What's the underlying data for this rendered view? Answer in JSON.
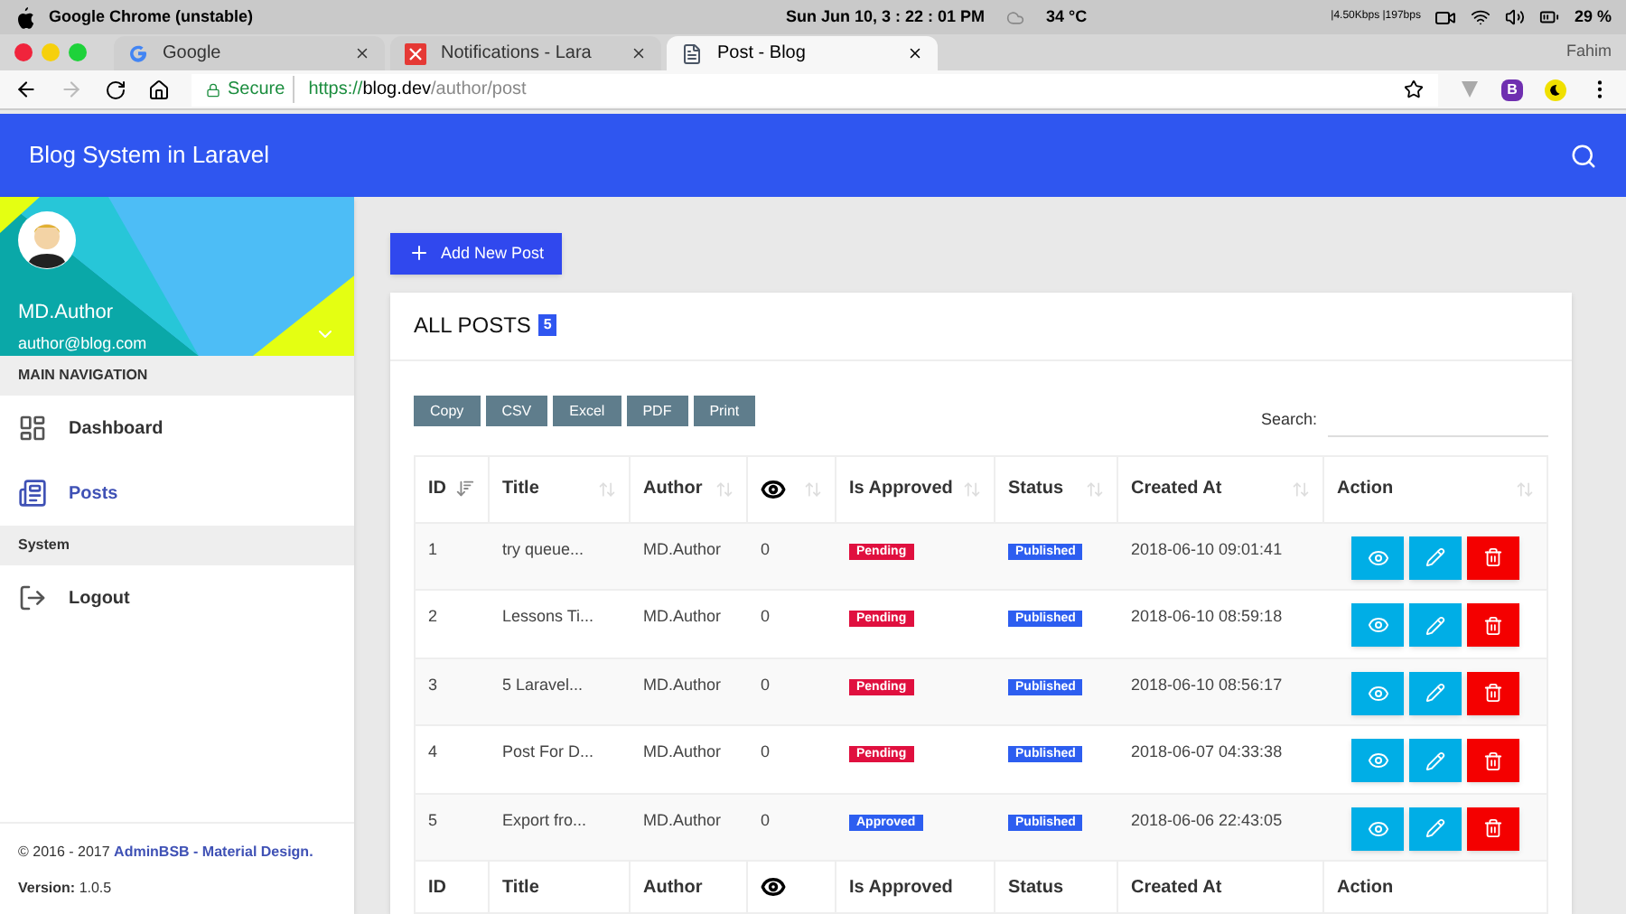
{
  "menu_bar": {
    "app_name": "Google Chrome (unstable)",
    "clock": "Sun Jun 10,  3 : 22 : 01 PM",
    "temperature": "34 °C",
    "network": "|4.50Kbps |197bps",
    "battery": "29 %"
  },
  "browser": {
    "tabs": [
      {
        "title": "Google",
        "selected": false,
        "kind": "google"
      },
      {
        "title": "Notifications - Lara",
        "selected": false,
        "kind": "app"
      },
      {
        "title": "Post - Blog",
        "selected": true,
        "kind": "page"
      }
    ],
    "profile": "Fahim",
    "extension_letter": "B",
    "secure_label": "Secure",
    "url_scheme": "https://",
    "url_host": "blog.dev",
    "url_path": "/author/post"
  },
  "app_bar": {
    "title": "Blog System in Laravel"
  },
  "sidebar": {
    "user_name": "MD.Author",
    "user_email": "author@blog.com",
    "sections": [
      {
        "header": "MAIN NAVIGATION",
        "items": [
          {
            "label": "Dashboard",
            "kind": "dashboard",
            "selected": false
          },
          {
            "label": "Posts",
            "kind": "posts",
            "selected": true
          }
        ]
      },
      {
        "header": "System",
        "items": [
          {
            "label": "Logout",
            "kind": "logout",
            "selected": false
          }
        ]
      }
    ],
    "copyright": "© 2016 - 2017 ",
    "copyright_link": "AdminBSB - Material Design.",
    "version_label": "Version:",
    "version": "1.0.5"
  },
  "add_button": "Add New Post",
  "card": {
    "title": "ALL POSTS",
    "count": "5",
    "export_buttons": [
      "Copy",
      "CSV",
      "Excel",
      "PDF",
      "Print"
    ],
    "search_label": "Search:"
  },
  "table": {
    "columns": [
      {
        "kind": "text",
        "label": "ID",
        "sorted": true
      },
      {
        "kind": "text",
        "label": "Title",
        "sorted": false
      },
      {
        "kind": "text",
        "label": "Author",
        "sorted": false
      },
      {
        "kind": "icon",
        "sorted": false
      },
      {
        "kind": "text",
        "label": "Is Approved",
        "sorted": false
      },
      {
        "kind": "text",
        "label": "Status",
        "sorted": false
      },
      {
        "kind": "text",
        "label": "Created At",
        "sorted": false
      },
      {
        "kind": "text",
        "label": "Action",
        "sorted": false
      }
    ],
    "rows": [
      {
        "id": "1",
        "title": "try queue...",
        "author": "MD.Author",
        "views": "0",
        "approval": {
          "label": "Pending",
          "kind": "pending"
        },
        "status": "Published",
        "created_at": "2018-06-10 09:01:41"
      },
      {
        "id": "2",
        "title": "Lessons Ti...",
        "author": "MD.Author",
        "views": "0",
        "approval": {
          "label": "Pending",
          "kind": "pending"
        },
        "status": "Published",
        "created_at": "2018-06-10 08:59:18"
      },
      {
        "id": "3",
        "title": "5 Laravel...",
        "author": "MD.Author",
        "views": "0",
        "approval": {
          "label": "Pending",
          "kind": "pending"
        },
        "status": "Published",
        "created_at": "2018-06-10 08:56:17"
      },
      {
        "id": "4",
        "title": "Post For D...",
        "author": "MD.Author",
        "views": "0",
        "approval": {
          "label": "Pending",
          "kind": "pending"
        },
        "status": "Published",
        "created_at": "2018-06-07 04:33:38"
      },
      {
        "id": "5",
        "title": "Export fro...",
        "author": "MD.Author",
        "views": "0",
        "approval": {
          "label": "Approved",
          "kind": "approved"
        },
        "status": "Published",
        "created_at": "2018-06-06 22:43:05"
      }
    ],
    "footer": [
      {
        "kind": "text",
        "label": "ID"
      },
      {
        "kind": "text",
        "label": "Title"
      },
      {
        "kind": "text",
        "label": "Author"
      },
      {
        "kind": "icon"
      },
      {
        "kind": "text",
        "label": "Is Approved"
      },
      {
        "kind": "text",
        "label": "Status"
      },
      {
        "kind": "text",
        "label": "Created At"
      },
      {
        "kind": "text",
        "label": "Action"
      }
    ]
  }
}
